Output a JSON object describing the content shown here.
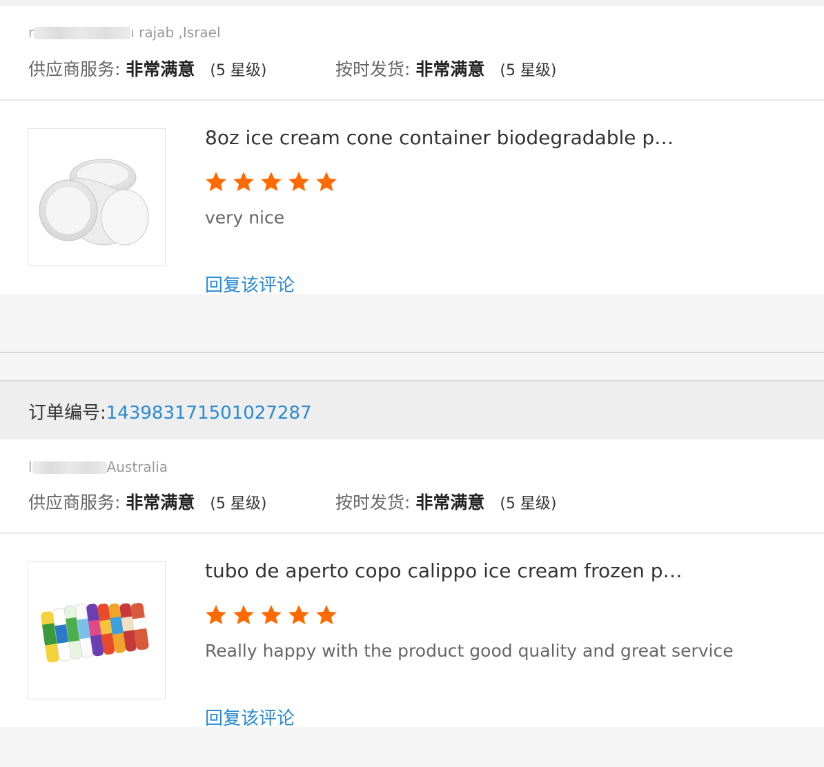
{
  "reviews": [
    {
      "reviewer_location": "rajab ,Israel",
      "supplier_service_label": "供应商服务:",
      "supplier_service_value": "非常满意",
      "supplier_service_stars": "(5 星级)",
      "shipping_label": "按时发货:",
      "shipping_value": "非常满意",
      "shipping_stars": "(5 星级)",
      "product_title": "8oz ice cream cone container biodegradable p…",
      "rating": 5,
      "comment": "very nice",
      "reply_label": "回复该评论"
    },
    {
      "order_label": "订单编号:",
      "order_number": "143983171501027287",
      "reviewer_location": "Australia",
      "supplier_service_label": "供应商服务:",
      "supplier_service_value": "非常满意",
      "supplier_service_stars": "(5 星级)",
      "shipping_label": "按时发货:",
      "shipping_value": "非常满意",
      "shipping_stars": "(5 星级)",
      "product_title": "tubo de aperto copo calippo ice cream frozen p…",
      "rating": 5,
      "comment": "Really happy with the product good quality and great service",
      "reply_label": "回复该评论"
    }
  ],
  "colors": {
    "star": "#ff6a00",
    "link": "#2a8ad4"
  }
}
